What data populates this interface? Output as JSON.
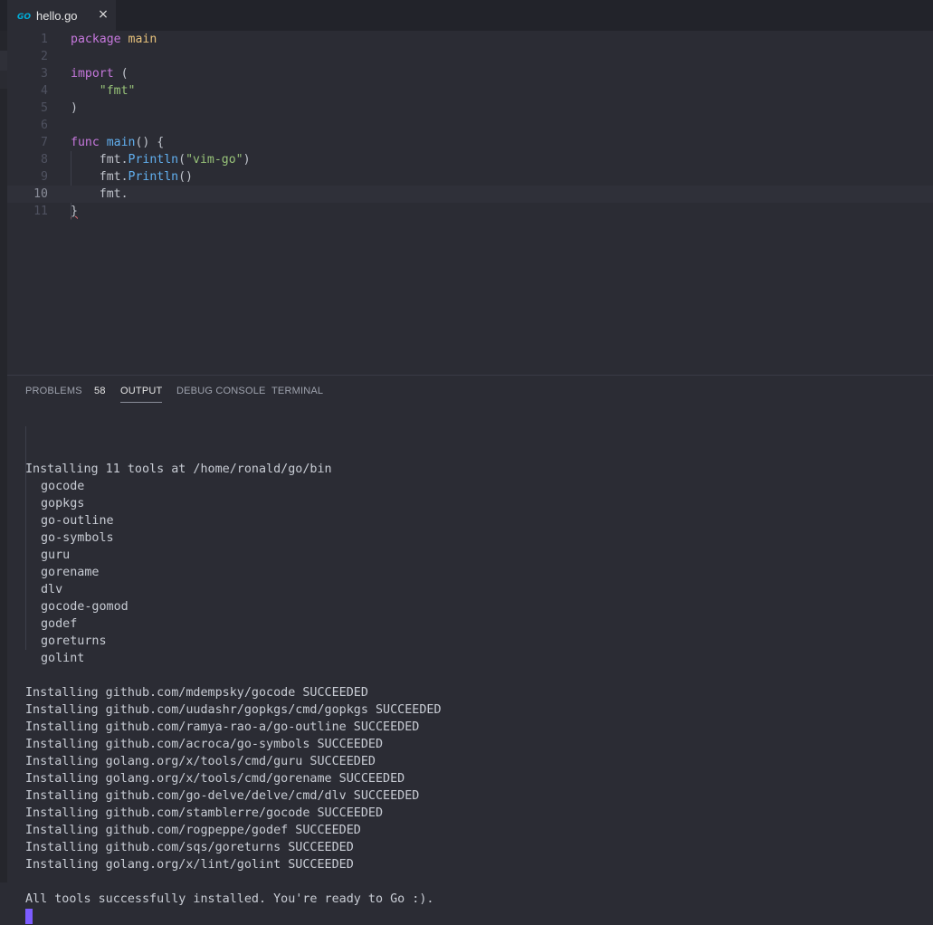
{
  "tab": {
    "filename": "hello.go",
    "icon": "go-file-icon",
    "close": "×"
  },
  "editor": {
    "lines": [
      {
        "n": "1",
        "tokens": [
          {
            "t": "package",
            "c": "kw-pkg"
          },
          {
            "t": " ",
            "c": "plain"
          },
          {
            "t": "main",
            "c": "id"
          }
        ]
      },
      {
        "n": "2",
        "tokens": []
      },
      {
        "n": "3",
        "tokens": [
          {
            "t": "import",
            "c": "kw-pkg"
          },
          {
            "t": " (",
            "c": "plain"
          }
        ]
      },
      {
        "n": "4",
        "tokens": [
          {
            "t": "    ",
            "c": "plain"
          },
          {
            "t": "\"fmt\"",
            "c": "str"
          }
        ]
      },
      {
        "n": "5",
        "tokens": [
          {
            "t": ")",
            "c": "plain"
          }
        ]
      },
      {
        "n": "6",
        "tokens": []
      },
      {
        "n": "7",
        "tokens": [
          {
            "t": "func",
            "c": "kw-pkg"
          },
          {
            "t": " ",
            "c": "plain"
          },
          {
            "t": "main",
            "c": "fn"
          },
          {
            "t": "() {",
            "c": "plain"
          }
        ]
      },
      {
        "n": "8",
        "tokens": [
          {
            "t": "    fmt.",
            "c": "plain"
          },
          {
            "t": "Println",
            "c": "fn"
          },
          {
            "t": "(",
            "c": "plain"
          },
          {
            "t": "\"vim-go\"",
            "c": "str"
          },
          {
            "t": ")",
            "c": "plain"
          }
        ]
      },
      {
        "n": "9",
        "tokens": [
          {
            "t": "    fmt.",
            "c": "plain"
          },
          {
            "t": "Println",
            "c": "fn"
          },
          {
            "t": "()",
            "c": "plain"
          }
        ]
      },
      {
        "n": "10",
        "tokens": [
          {
            "t": "    fmt.",
            "c": "plain"
          }
        ],
        "active": true
      },
      {
        "n": "11",
        "tokens": [
          {
            "t": "}",
            "c": "plain brace-err"
          }
        ]
      }
    ]
  },
  "panel": {
    "tabs": [
      {
        "label": "PROBLEMS",
        "badge": "58",
        "active": false
      },
      {
        "label": "OUTPUT",
        "active": true
      },
      {
        "label": "DEBUG CONSOLE",
        "active": false
      },
      {
        "label": "TERMINAL",
        "active": false
      }
    ],
    "output_header": "Installing 11 tools at /home/ronald/go/bin",
    "tools": [
      "gocode",
      "gopkgs",
      "go-outline",
      "go-symbols",
      "guru",
      "gorename",
      "dlv",
      "gocode-gomod",
      "godef",
      "goreturns",
      "golint"
    ],
    "results": [
      "Installing github.com/mdempsky/gocode SUCCEEDED",
      "Installing github.com/uudashr/gopkgs/cmd/gopkgs SUCCEEDED",
      "Installing github.com/ramya-rao-a/go-outline SUCCEEDED",
      "Installing github.com/acroca/go-symbols SUCCEEDED",
      "Installing golang.org/x/tools/cmd/guru SUCCEEDED",
      "Installing golang.org/x/tools/cmd/gorename SUCCEEDED",
      "Installing github.com/go-delve/delve/cmd/dlv SUCCEEDED",
      "Installing github.com/stamblerre/gocode SUCCEEDED",
      "Installing github.com/rogpeppe/godef SUCCEEDED",
      "Installing github.com/sqs/goreturns SUCCEEDED",
      "Installing golang.org/x/lint/golint SUCCEEDED"
    ],
    "final_message": "All tools successfully installed. You're ready to Go :).",
    "cursor_color": "#7c5cff"
  }
}
